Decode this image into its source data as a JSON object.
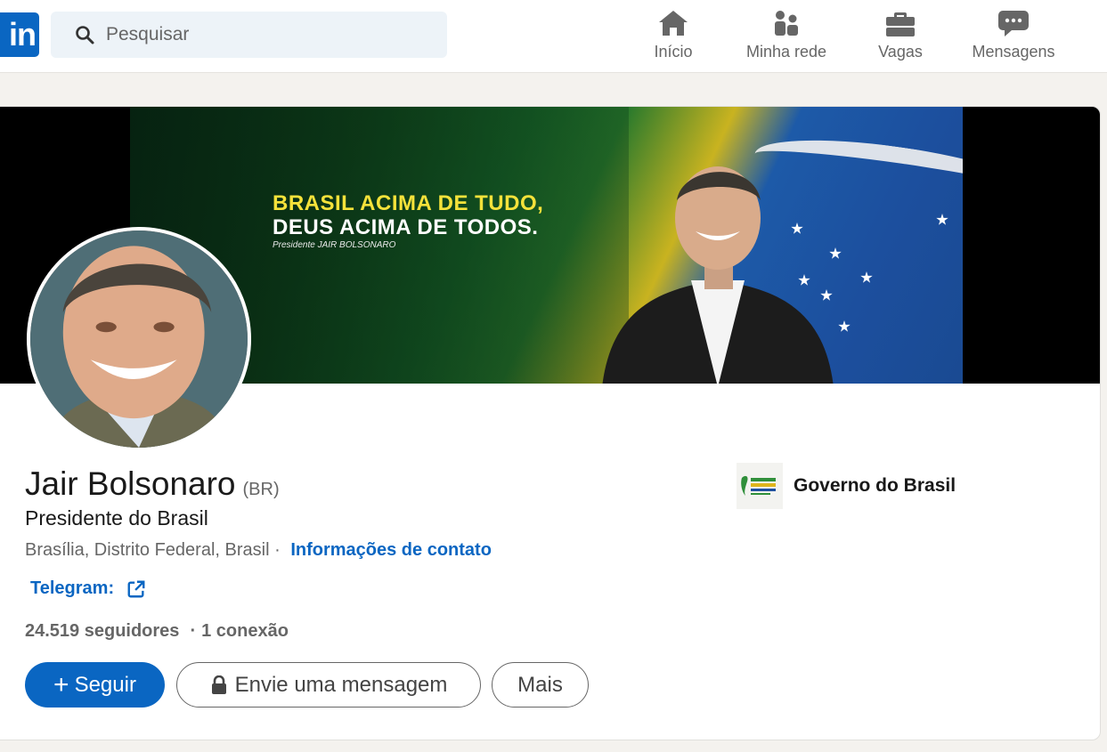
{
  "nav": {
    "logo_text": "in",
    "search_placeholder": "Pesquisar",
    "items": [
      {
        "label": "Início",
        "icon": "home-icon"
      },
      {
        "label": "Minha rede",
        "icon": "network-icon"
      },
      {
        "label": "Vagas",
        "icon": "briefcase-icon"
      },
      {
        "label": "Mensagens",
        "icon": "messaging-icon"
      }
    ]
  },
  "banner": {
    "line1": "BRASIL ACIMA DE TUDO,",
    "line2": "DEUS ACIMA DE TODOS.",
    "signature": "Presidente JAIR BOLSONARO"
  },
  "profile": {
    "name": "Jair Bolsonaro",
    "pronoun": "(BR)",
    "headline": "Presidente do Brasil",
    "location": "Brasília, Distrito Federal, Brasil",
    "location_sep": "·",
    "contact_link": "Informações de contato",
    "website_label": "Telegram:",
    "followers": "24.519 seguidores",
    "connections": "1 conexão",
    "stats_sep": "·"
  },
  "actions": {
    "follow": "Seguir",
    "message": "Envie uma mensagem",
    "more": "Mais"
  },
  "company": {
    "name": "Governo do Brasil"
  },
  "colors": {
    "accent": "#0a66c2",
    "background": "#f4f2ee",
    "text_secondary": "#666666",
    "slogan_yellow": "#f5e23a"
  }
}
